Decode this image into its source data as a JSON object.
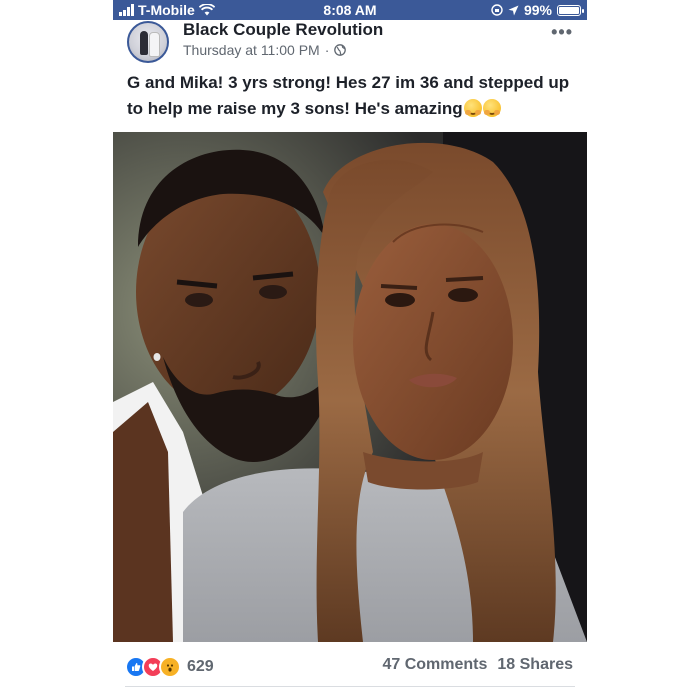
{
  "status_bar": {
    "carrier": "T-Mobile",
    "time": "8:08 AM",
    "battery": "99%",
    "battery_level": 0.99
  },
  "post": {
    "page_name": "Black Couple Revolution",
    "timestamp": "Thursday at 11:00 PM",
    "separator": "·",
    "privacy_icon": "globe-icon",
    "more_label": "•••",
    "caption": "G and Mika! 3 yrs strong! Hes 27 im 36 and stepped up to help me raise my 3 sons! He's amazing",
    "caption_emojis": [
      "hugging-face-emoji",
      "hugging-face-emoji"
    ],
    "reaction_icons": [
      "like-icon",
      "love-icon",
      "wow-icon"
    ],
    "reaction_count": "629",
    "comments": "47 Comments",
    "shares": "18 Shares"
  },
  "colors": {
    "status_bar_bg": "#3b5998",
    "text_primary": "#1d2129",
    "text_secondary": "#606770",
    "like": "#1877f2",
    "love": "#f33e58",
    "wow": "#f7b125"
  }
}
